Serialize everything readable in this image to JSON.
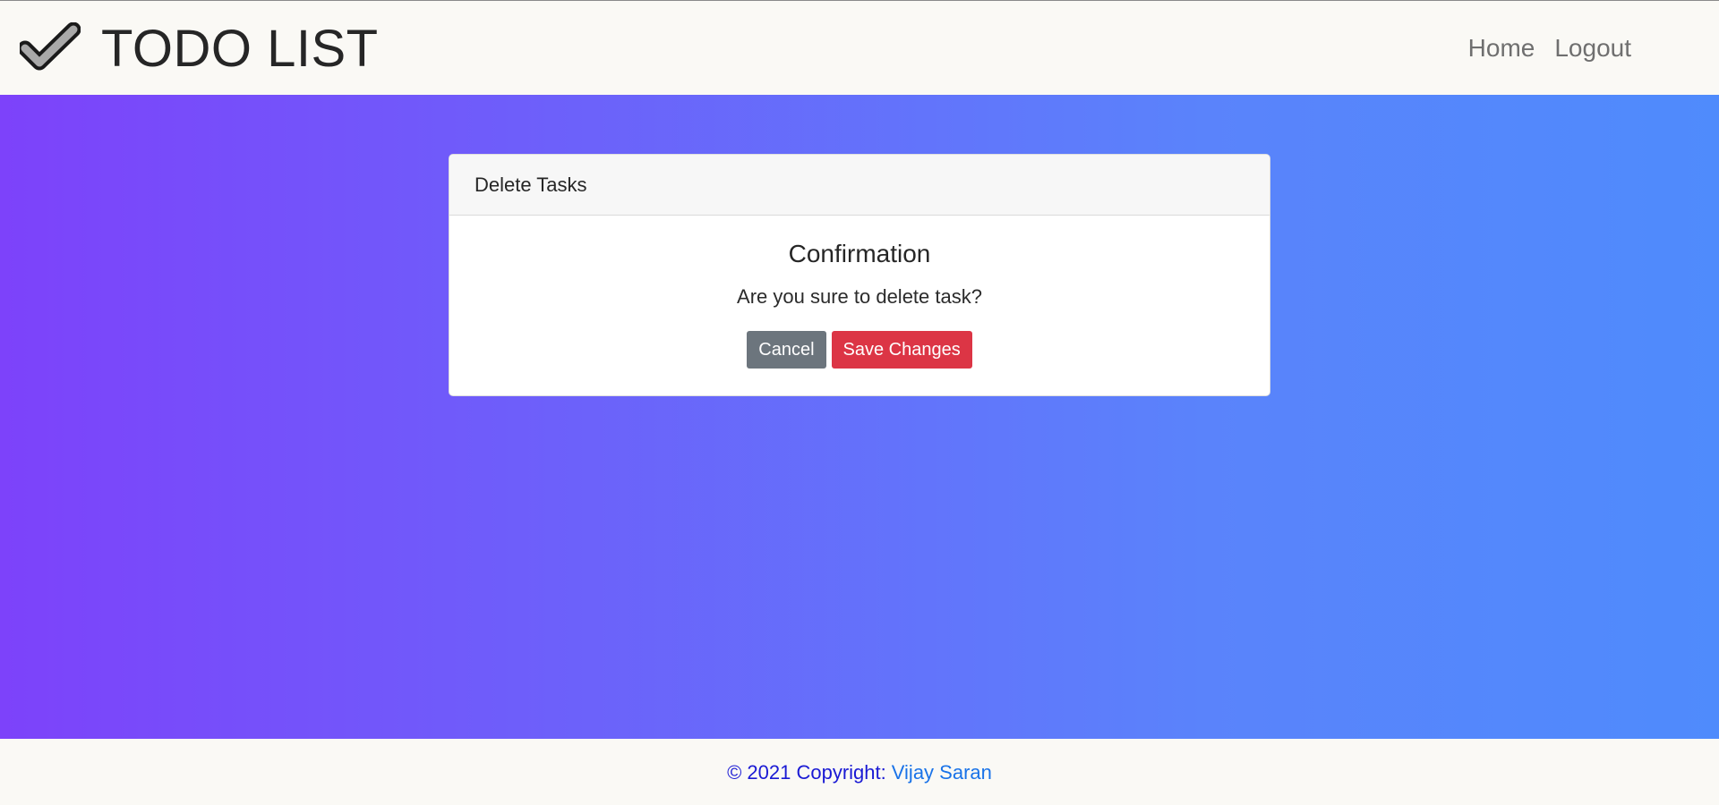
{
  "navbar": {
    "brand_title": "TODO LIST",
    "logo_icon": "checkmark-icon",
    "links": [
      {
        "label": "Home"
      },
      {
        "label": "Logout"
      }
    ]
  },
  "hero": {
    "gradient_start": "#7d42fa",
    "gradient_end": "#4f8bfc"
  },
  "card": {
    "header": "Delete Tasks",
    "title": "Confirmation",
    "text": "Are you sure to delete task?",
    "cancel_label": "Cancel",
    "save_label": "Save Changes",
    "cancel_color": "#6c757d",
    "save_color": "#dc3545"
  },
  "footer": {
    "copyright": "© 2021 Copyright:",
    "author": "Vijay Saran"
  }
}
